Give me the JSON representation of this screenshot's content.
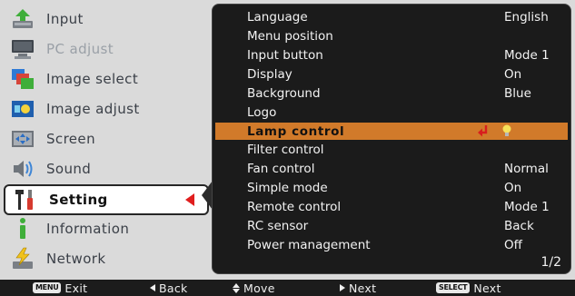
{
  "menu": {
    "items": [
      {
        "label": "Input",
        "icon": "input-icon",
        "state": "enabled"
      },
      {
        "label": "PC adjust",
        "icon": "monitor-icon",
        "state": "disabled"
      },
      {
        "label": "Image select",
        "icon": "image-select-icon",
        "state": "enabled"
      },
      {
        "label": "Image adjust",
        "icon": "image-adjust-icon",
        "state": "enabled"
      },
      {
        "label": "Screen",
        "icon": "screen-icon",
        "state": "enabled"
      },
      {
        "label": "Sound",
        "icon": "speaker-icon",
        "state": "enabled"
      },
      {
        "label": "Setting",
        "icon": "tools-icon",
        "state": "selected"
      },
      {
        "label": "Information",
        "icon": "info-icon",
        "state": "enabled"
      },
      {
        "label": "Network",
        "icon": "network-icon",
        "state": "enabled"
      }
    ]
  },
  "settings": {
    "rows": [
      {
        "key": "Language",
        "value": "English"
      },
      {
        "key": "Menu position",
        "value": ""
      },
      {
        "key": "Input button",
        "value": "Mode 1"
      },
      {
        "key": "Display",
        "value": "On"
      },
      {
        "key": "Background",
        "value": "Blue"
      },
      {
        "key": "Logo",
        "value": ""
      },
      {
        "key": "Lamp control",
        "value": "",
        "highlighted": true
      },
      {
        "key": "Filter control",
        "value": ""
      },
      {
        "key": "Fan control",
        "value": "Normal"
      },
      {
        "key": "Simple mode",
        "value": "On"
      },
      {
        "key": "Remote control",
        "value": "Mode 1"
      },
      {
        "key": "RC sensor",
        "value": "Back"
      },
      {
        "key": "Power management",
        "value": "Off"
      }
    ],
    "page": "1/2"
  },
  "bottom_bar": {
    "exit_key": "MENU",
    "exit_label": "Exit",
    "back_label": "Back",
    "move_label": "Move",
    "next_label": "Next",
    "select_key": "SELECT",
    "select_next_label": "Next"
  },
  "colors": {
    "highlight": "#d17a2a",
    "selected_arrow": "#e01e1e",
    "panel_bg": "#1b1b1b",
    "menu_bg": "#dadada"
  }
}
